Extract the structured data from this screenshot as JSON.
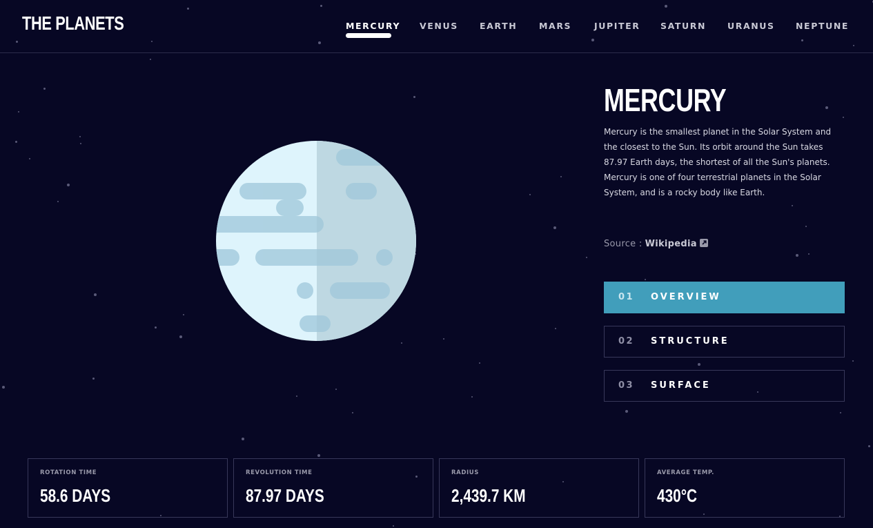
{
  "app": {
    "logo": "THE PLANETS"
  },
  "nav": {
    "items": [
      {
        "label": "MERCURY",
        "active": true
      },
      {
        "label": "VENUS",
        "active": false
      },
      {
        "label": "EARTH",
        "active": false
      },
      {
        "label": "MARS",
        "active": false
      },
      {
        "label": "JUPITER",
        "active": false
      },
      {
        "label": "SATURN",
        "active": false
      },
      {
        "label": "URANUS",
        "active": false
      },
      {
        "label": "NEPTUNE",
        "active": false
      }
    ]
  },
  "planet": {
    "name": "MERCURY",
    "description": "Mercury is the smallest planet in the Solar System and the closest to the Sun. Its orbit around the Sun takes 87.97 Earth days, the shortest of all the Sun's planets. Mercury is one of four terrestrial planets in the Solar System, and is a rocky body like Earth.",
    "source_label": "Source :",
    "source_link": "Wikipedia",
    "source_icon": "external-link-icon"
  },
  "tabs": [
    {
      "num": "01",
      "label": "OVERVIEW",
      "active": true
    },
    {
      "num": "02",
      "label": "STRUCTURE",
      "active": false
    },
    {
      "num": "03",
      "label": "SURFACE",
      "active": false
    }
  ],
  "stats": [
    {
      "label": "ROTATION TIME",
      "value": "58.6 DAYS"
    },
    {
      "label": "REVOLUTION TIME",
      "value": "87.97 DAYS"
    },
    {
      "label": "RADIUS",
      "value": "2,439.7 KM"
    },
    {
      "label": "AVERAGE TEMP.",
      "value": "430°C"
    }
  ],
  "colors": {
    "background": "#070724",
    "accent": "#419ebb",
    "planet_light": "#def4fc",
    "planet_dark": "#c9e0e8",
    "crater": "#a9cfe0"
  }
}
